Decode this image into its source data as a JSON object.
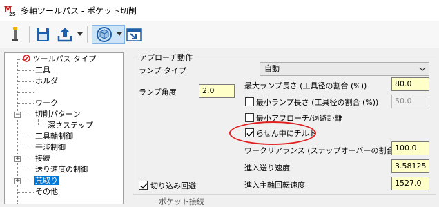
{
  "window": {
    "title": "多軸ツールパス - ポケット切削"
  },
  "tree": {
    "items": [
      {
        "label": "ツールパス タイプ"
      },
      {
        "label": "工具"
      },
      {
        "label": "ホルダ"
      },
      {
        "label": ""
      },
      {
        "label": "ワーク"
      },
      {
        "label": "切削パターン"
      },
      {
        "label": "深さステップ"
      },
      {
        "label": "工具軸制御"
      },
      {
        "label": "干渉制御"
      },
      {
        "label": "接続"
      },
      {
        "label": "送り速度の制御"
      },
      {
        "label": "荒取り"
      },
      {
        "label": "その他"
      }
    ]
  },
  "approach": {
    "group_title": "アプローチ動作",
    "ramp_type_label": "ランプ タイプ",
    "ramp_type_value": "自動",
    "ramp_angle_label": "ランプ角度",
    "ramp_angle_value": "2.0",
    "max_ramp_label": "最大ランプ長さ (工具径の割合 (%))",
    "max_ramp_value": "80.0",
    "min_ramp_label": "最小ランプ長さ (工具径の割合 (%))",
    "min_ramp_value": "50.0",
    "min_approach_label": "最小アプローチ/退避距離",
    "spiral_tilt_label": "らせん中にチルト",
    "clearance_label": "ワークリアランス (ステップオーバーの割合(%))",
    "clearance_value": "100.0",
    "feed_label": "進入送り速度",
    "feed_value": "3.58125",
    "spindle_label": "進入主軸回転速度",
    "spindle_value": "1527.0",
    "plunge_avoid_label": "切り込み回避",
    "min_ramp_checked": false,
    "min_approach_checked": false,
    "spiral_tilt_checked": true,
    "plunge_avoid_checked": true
  },
  "bottom": {
    "partial_title": "ポケット接続"
  },
  "colors": {
    "selection": "#0078d7",
    "field_bg": "#ffffc8",
    "highlight": "#e02020"
  }
}
